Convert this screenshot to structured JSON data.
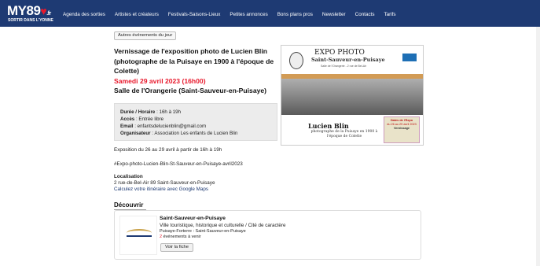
{
  "header": {
    "logo": {
      "main": "MY89",
      "suffix": ".fr",
      "tagline": "SORTIR DANS L'YONNE"
    },
    "menu": [
      "Agenda des sorties",
      "Artistes et créateurs",
      "Festivals-Saisons-Lieux",
      "Petites annonces",
      "Bons plans pros",
      "Newsletter",
      "Contacts",
      "Tarifs"
    ]
  },
  "toolbar": {
    "other_events_label": "Autres événements du jour"
  },
  "event": {
    "title": "Vernissage de l'exposition photo de Lucien Blin (photographe de la Puisaye en 1900 à l'époque de Colette)",
    "date": "Samedi 29 avril 2023 (16h00)",
    "venue": "Salle de l'Orangerie (Saint-Sauveur-en-Puisaye)",
    "info": {
      "duration_label": "Durée / Horaire",
      "duration_value": " : 16h à 19h",
      "access_label": "Accès",
      "access_value": " : Entrée libre",
      "email_label": "Email",
      "email_value": " : enfantsdelucienblin@gmail.com",
      "org_label": "Organisateur",
      "org_value": " : Association Les enfants de Lucien Blin"
    },
    "description": "Exposition du 26 au 29 avril à partir de 16h à 19h",
    "hashtag": "#Expo-photo-Lucien-Blin-St-Sauveur-en-Puisaye-avril2023",
    "location": {
      "heading": "Localisation",
      "address": "2 rue-de-Bel-Air 89 Saint-Sauveur-en-Puisaye",
      "route_link": "Calculez votre itinéraire avec Google Maps"
    }
  },
  "poster": {
    "title": "EXPO PHOTO",
    "subtitle": "Saint-Sauveur-en-Puisaye",
    "address": "Salle de l'Orangerie - 2 rue de Bel-Air",
    "name": "Lucien Blin",
    "desc": "photographe de la Puisaye en 1900 à l'époque de Colette",
    "dates_title": "Dates de l'Expo",
    "dates_value": "du 26 au 29 avril 2023",
    "vernissage": "Vernissage"
  },
  "discover": {
    "heading": "Découvrir",
    "card": {
      "name": "Saint-Sauveur-en-Puisaye",
      "category": "Ville touristique, historique et culturelle / Cité de caractère",
      "location": "Puisaye-Forterre : Saint-Sauveur-en-Puisaye",
      "events_count": "2",
      "events_label": " événements à venir",
      "button": "Voir la fiche"
    }
  },
  "colors": {
    "nav": "#1e3a73",
    "accent": "#e8192c"
  }
}
